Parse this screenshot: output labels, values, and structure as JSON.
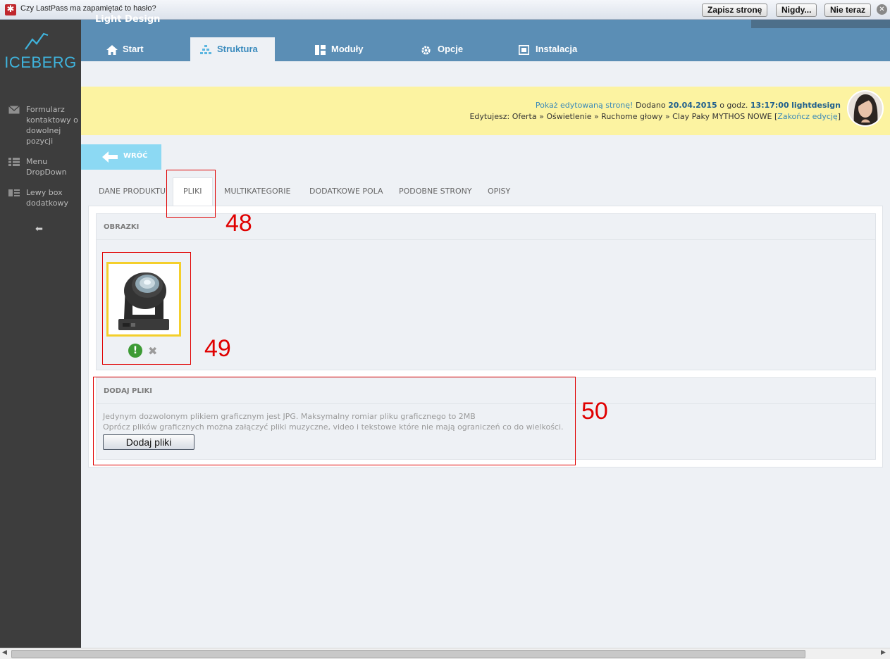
{
  "lastpass": {
    "prompt": "Czy LastPass ma zapamiętać to hasło?",
    "buttons": [
      "Zapisz stronę",
      "Nigdy...",
      "Nie teraz"
    ]
  },
  "brand": {
    "name": "ICEBERG",
    "accent": "#3fb3dc"
  },
  "sidebar": {
    "items": [
      {
        "label": "Formularz kontaktowy o dowolnej pozycji",
        "icon": "envelope-icon"
      },
      {
        "label": "Menu DropDown",
        "icon": "menu-grid-icon"
      },
      {
        "label": "Lewy box dodatkowy",
        "icon": "list-box-icon"
      }
    ]
  },
  "header": {
    "title_cut": "Light Design",
    "tabs": [
      {
        "label": "Start",
        "icon": "home-icon",
        "active": false
      },
      {
        "label": "Struktura",
        "icon": "structure-icon",
        "active": true
      },
      {
        "label": "Moduły",
        "icon": "modules-icon",
        "active": false
      },
      {
        "label": "Opcje",
        "icon": "gear-icon",
        "active": false
      },
      {
        "label": "Instalacja",
        "icon": "install-icon",
        "active": false
      }
    ]
  },
  "info": {
    "show_link": "Pokaż edytowaną stronę!",
    "added_prefix": "Dodano",
    "date": "20.04.2015",
    "at": "o godz.",
    "time": "13:17:00",
    "user": "lightdesign",
    "editing_prefix": "Edytujesz:",
    "path": "Oferta » Oświetlenie » Ruchome głowy » Clay Paky MYTHOS NOWE",
    "bracket_open": "[",
    "end_link": "Zakończ edycję",
    "bracket_close": "]"
  },
  "back": {
    "label": "WRÓĆ"
  },
  "subtabs": [
    "DANE PRODUKTU",
    "PLIKI",
    "MULTIKATEGORIE",
    "DODATKOWE POLA",
    "PODOBNE STRONY",
    "OPISY"
  ],
  "images_section": {
    "title": "OBRAZKI"
  },
  "add_section": {
    "title": "DODAJ PLIKI",
    "help1": "Jedynym dozwolonym plikiem graficznym jest JPG. Maksymalny romiar pliku graficznego to 2MB",
    "help2": "Oprócz plików graficznych można załączyć pliki muzyczne, video i tekstowe które nie mają ograniczeń co do wielkości.",
    "button": "Dodaj pliki"
  },
  "annotations": [
    "48",
    "49",
    "50"
  ]
}
